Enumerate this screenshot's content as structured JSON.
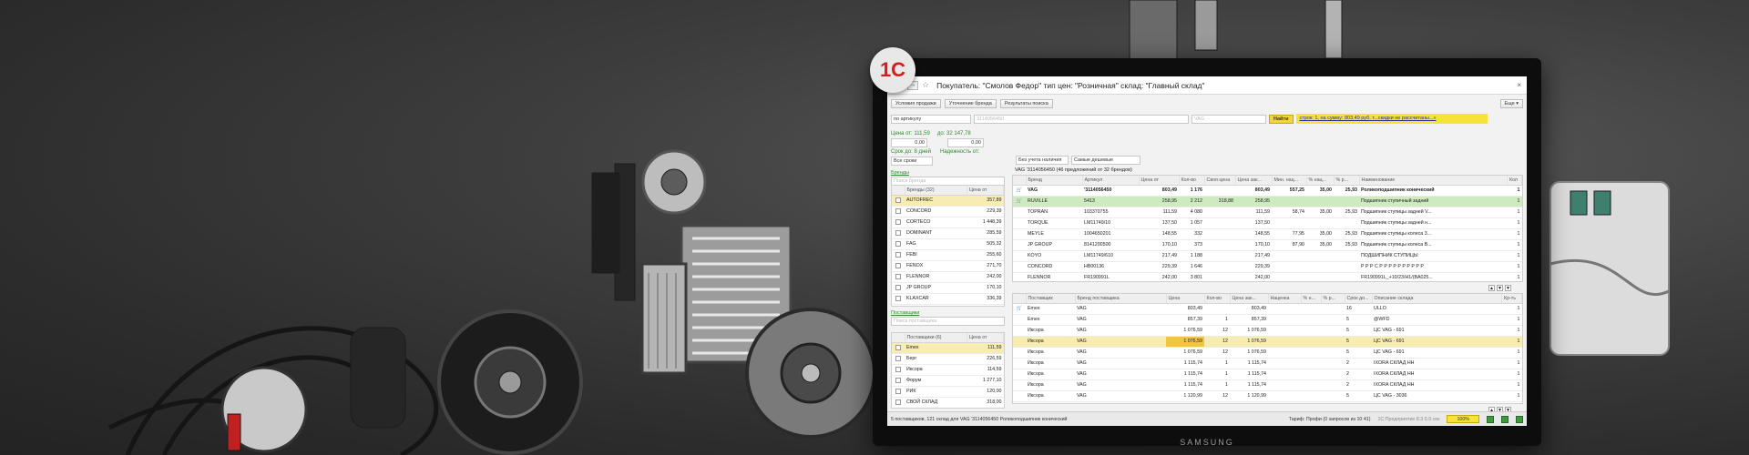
{
  "app": {
    "logo": "1С",
    "monitor_brand": "SAMSUNG"
  },
  "window": {
    "title": "Покупатель: \"Смолов Федор\" тип цен: \"Розничная\" склад: \"Главный склад\"",
    "back": "←",
    "forward": "→",
    "star": "☆",
    "close": "×"
  },
  "toolbar": {
    "sale_conditions": "Условия продажи",
    "refine_brand": "Уточнение бренда",
    "search_results": "Результаты поиска",
    "more": "Еще ▾"
  },
  "search": {
    "mode": "по артикулу",
    "article": "3114056450",
    "brand": "VAG",
    "find": "Найти",
    "banner": "строк: 1, на сумму: 803,49 руб. т...скидки не рассчитаны...»"
  },
  "filters": {
    "price_from_label": "Цена от: 111,59",
    "price_to_label": "до: 32 147,78",
    "price_from": "0,00",
    "price_to": "0,00",
    "term_label": "Срок до: 8 дней",
    "reliability_label": "Надежность от:",
    "all_terms": "Все сроки",
    "without_avail": "Без учета наличия",
    "cheapest": "Самые дешевые"
  },
  "brands_panel": {
    "section": "Бренды",
    "search_placeholder": "Поиск бренда",
    "col_brand": "Бренды (32)",
    "col_price": "Цена от",
    "rows": [
      [
        "AUTOFREC",
        "357,89"
      ],
      [
        "CONCORD",
        "229,39"
      ],
      [
        "CORTECO",
        "1 448,39"
      ],
      [
        "DOMINANT",
        "285,59"
      ],
      [
        "FAG",
        "505,32"
      ],
      [
        "FEBI",
        "255,60"
      ],
      [
        "FENOX",
        "271,70"
      ],
      [
        "FLENNOR",
        "242,00"
      ],
      [
        "JP GROUP",
        "170,10"
      ],
      [
        "KLAXCAR",
        "336,39"
      ]
    ]
  },
  "suppliers_panel": {
    "section": "Поставщики",
    "search_placeholder": "Поиск поставщика",
    "col_supplier": "Поставщики (6)",
    "col_price": "Цена от",
    "rows": [
      [
        "Emex",
        "111,59"
      ],
      [
        "Берг",
        "226,59"
      ],
      [
        "Иксора",
        "114,59"
      ],
      [
        "Форум",
        "1 277,10"
      ],
      [
        "РИК",
        "120,00"
      ],
      [
        "СВОЙ СКЛАД",
        "318,00"
      ]
    ]
  },
  "brands_grid": {
    "header": "VAG '3114056450 (46 предложений от 32 брендов)",
    "cols": [
      "Бренд",
      "Артикул",
      "Цена от",
      "Кол-во",
      "Своя цена",
      "Цена зак...",
      "Мин. нац...",
      "% нац...",
      "% р...",
      "Наименование",
      "Кол"
    ],
    "rows": [
      [
        "VAG",
        "'3114056450",
        "803,49",
        "1 176",
        "",
        "803,49",
        "557,25",
        "35,00",
        "25,93",
        "Роликоподшипник конический",
        "1"
      ],
      [
        "RUVILLE",
        "5413",
        "258,95",
        "2 212",
        "318,88",
        "258,95",
        "",
        "",
        "",
        "Подшипник ступичный задний",
        "1"
      ],
      [
        "TOPRAN",
        "103370755",
        "111,59",
        "4 080",
        "",
        "111,59",
        "58,74",
        "35,00",
        "25,93",
        "Подшипник ступицы задней V...",
        "1"
      ],
      [
        "TORQUE",
        "LM11749/10",
        "137,50",
        "1 057",
        "",
        "137,50",
        "",
        "",
        "",
        "Подшипник ступицы задней н...",
        "1"
      ],
      [
        "MEYLE",
        "1004650201",
        "148,55",
        "332",
        "",
        "148,55",
        "77,95",
        "35,00",
        "25,93",
        "Подшипник ступицы колеса 3...",
        "1"
      ],
      [
        "JP GROUP",
        "8141200500",
        "170,10",
        "373",
        "",
        "170,10",
        "87,90",
        "35,00",
        "25,93",
        "Подшипник ступицы колеса В...",
        "1"
      ],
      [
        "KOYO",
        "LM11749/610",
        "217,49",
        "1 188",
        "",
        "217,49",
        "",
        "",
        "",
        "ПОДШИПНИК СТУПИЦЫ",
        "1"
      ],
      [
        "CONCORD",
        "HB00136",
        "229,39",
        "1 646",
        "",
        "229,39",
        "",
        "",
        "",
        "Р Р Р С Р Р Р Р Р Р Р Р Р Р",
        "1"
      ],
      [
        "FLENNOR",
        "FR190991L",
        "242,00",
        "3 801",
        "",
        "242,00",
        "",
        "",
        "",
        "FR190991L_+10/23/H1/(BA025...",
        "1"
      ]
    ]
  },
  "offers_grid": {
    "cols": [
      "Поставщик",
      "Бренд поставщика",
      "Цена",
      "Кол-во",
      "Цена зак...",
      "Наценка",
      "% н...",
      "% р...",
      "Срок до...",
      "Описание склада",
      "Кр-ть"
    ],
    "rows": [
      [
        "Emex",
        "VAG",
        "803,49",
        "",
        "803,49",
        "",
        "",
        "",
        "16",
        "ULLO",
        "1"
      ],
      [
        "Emex",
        "VAG",
        "857,39",
        "1",
        "857,39",
        "",
        "",
        "",
        "5",
        "@WFD",
        "1"
      ],
      [
        "Иксора",
        "VAG",
        "1 076,59",
        "12",
        "1 076,59",
        "",
        "",
        "",
        "5",
        "ЦС VAG - 691",
        "1"
      ],
      [
        "Иксора",
        "VAG",
        "1 076,59",
        "12",
        "1 076,59",
        "",
        "",
        "",
        "5",
        "ЦС VAG - 691",
        "1"
      ],
      [
        "Иксора",
        "VAG",
        "1 076,59",
        "12",
        "1 076,59",
        "",
        "",
        "",
        "5",
        "ЦС VAG - 691",
        "1"
      ],
      [
        "Иксора",
        "VAG",
        "1 115,74",
        "1",
        "1 115,74",
        "",
        "",
        "",
        "2",
        "IXORA СКЛАД НН",
        "1"
      ],
      [
        "Иксора",
        "VAG",
        "1 115,74",
        "1",
        "1 115,74",
        "",
        "",
        "",
        "2",
        "IXORA СКЛАД НН",
        "1"
      ],
      [
        "Иксора",
        "VAG",
        "1 115,74",
        "1",
        "1 115,74",
        "",
        "",
        "",
        "2",
        "IXORA СКЛАД НН",
        "1"
      ],
      [
        "Иксора",
        "VAG",
        "1 120,99",
        "12",
        "1 120,99",
        "",
        "",
        "",
        "5",
        "ЦС VAG - 3036",
        "1"
      ]
    ]
  },
  "status": {
    "left": "5 поставщиков, 121 склад для VAG '3114056450 Роликоподшипник конический",
    "tariff": "Тариф: Профи (0 запросов из 10 41)",
    "platform": "1C:Предприятие 8.3 0.9 сек",
    "zoom": "100%"
  },
  "colors": {
    "accent_yellow": "#f7e23a",
    "highlight_row": "#f8ecb0",
    "highlight_green": "#cfe9c1",
    "logo_red": "#d41c1c"
  }
}
